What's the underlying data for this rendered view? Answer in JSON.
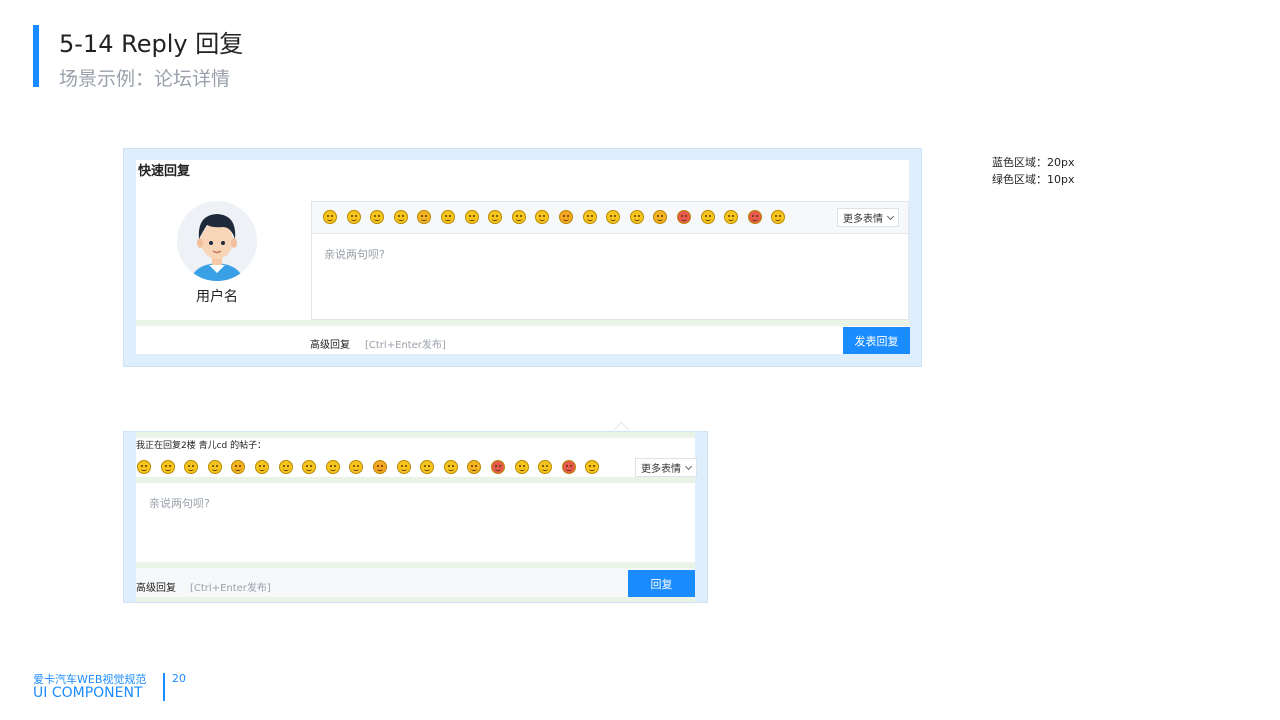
{
  "header": {
    "title": "5-14  Reply 回复",
    "subtitle": "场景示例：论坛详情"
  },
  "legend": {
    "blue": "蓝色区域：20px",
    "green": "绿色区域：10px"
  },
  "quick_reply": {
    "title": "快速回复",
    "username": "用户名",
    "more_emoji_label": "更多表情",
    "placeholder": "亲说两句呗?",
    "advanced_reply": "高级回复",
    "shortcut_hint": "[Ctrl+Enter发布]",
    "submit_label": "发表回复"
  },
  "inline_reply": {
    "replying_to": "我正在回复2楼 青儿cd 的帖子：",
    "more_emoji_label": "更多表情",
    "placeholder": "亲说两句呗?",
    "advanced_reply": "高级回复",
    "shortcut_hint": "[Ctrl+Enter发布]",
    "submit_label": "回复"
  },
  "emoji_colors": [
    "#f7c51e",
    "#f7c51e",
    "#f7c51e",
    "#f7c51e",
    "#f5b324",
    "#f7c51e",
    "#f7c51e",
    "#f7c51e",
    "#f7c51e",
    "#f7c51e",
    "#f5a623",
    "#f7c51e",
    "#f7c51e",
    "#f7c51e",
    "#f5b324",
    "#e85a4f",
    "#f7c51e",
    "#f7c51e",
    "#e85a4f",
    "#f7c51e"
  ],
  "colors": {
    "accent": "#1a8cff",
    "blue_area": "#deeefc",
    "green_area": "#e9f3e6"
  },
  "footer": {
    "brand_cn": "爱卡汽车WEB视觉规范",
    "brand_en": "UI COMPONENT",
    "page_number": "20"
  }
}
